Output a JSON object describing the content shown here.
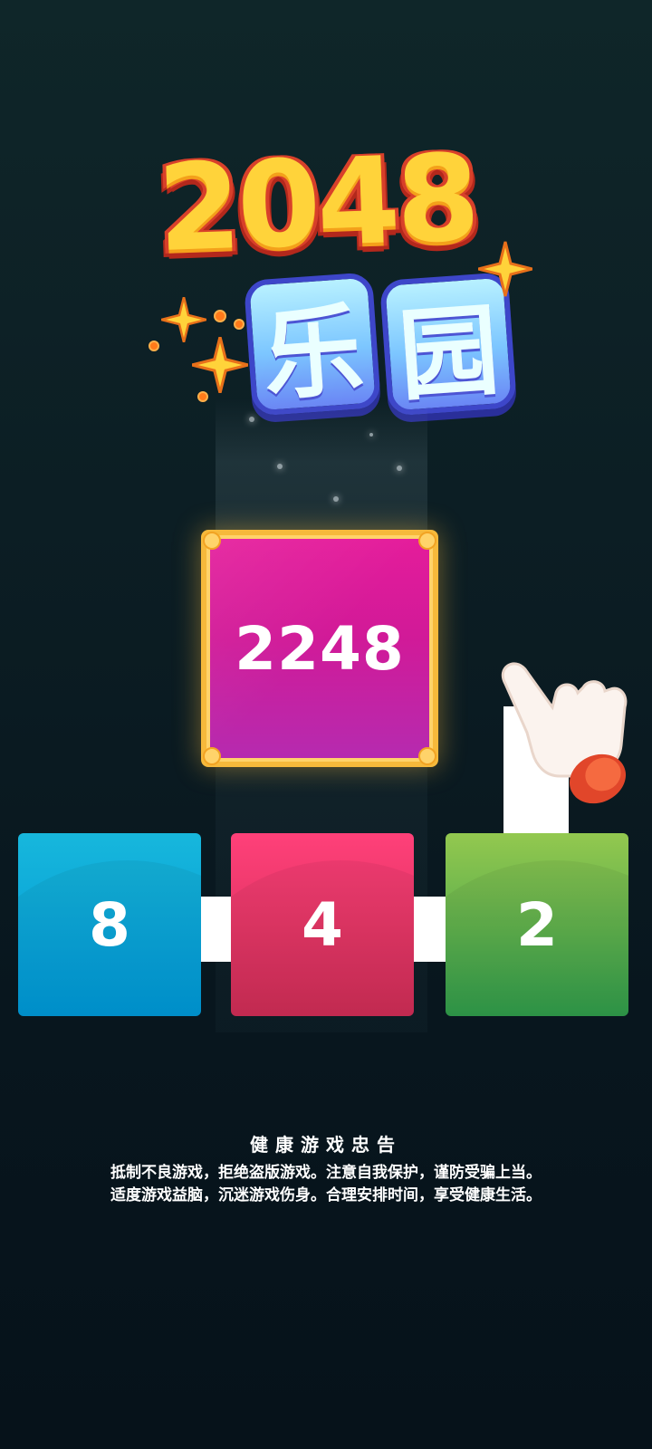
{
  "logo": {
    "number": "2048",
    "chars": [
      "乐",
      "园"
    ]
  },
  "game": {
    "merged_tile": {
      "value": "2248",
      "color": "#d11a98",
      "border_color": "#f6b93b"
    },
    "tiles": [
      {
        "value": "8",
        "color": "#0096d4"
      },
      {
        "value": "4",
        "color": "#e23560"
      },
      {
        "value": "2",
        "color": "#4ea84a"
      }
    ],
    "icons": [
      "sparkle-icon",
      "pointing-hand-icon"
    ]
  },
  "notice": {
    "title": "健康游戏忠告",
    "lines": [
      "抵制不良游戏，拒绝盗版游戏。注意自我保护，谨防受骗上当。",
      "适度游戏益脑，沉迷游戏伤身。合理安排时间，享受健康生活。"
    ]
  }
}
